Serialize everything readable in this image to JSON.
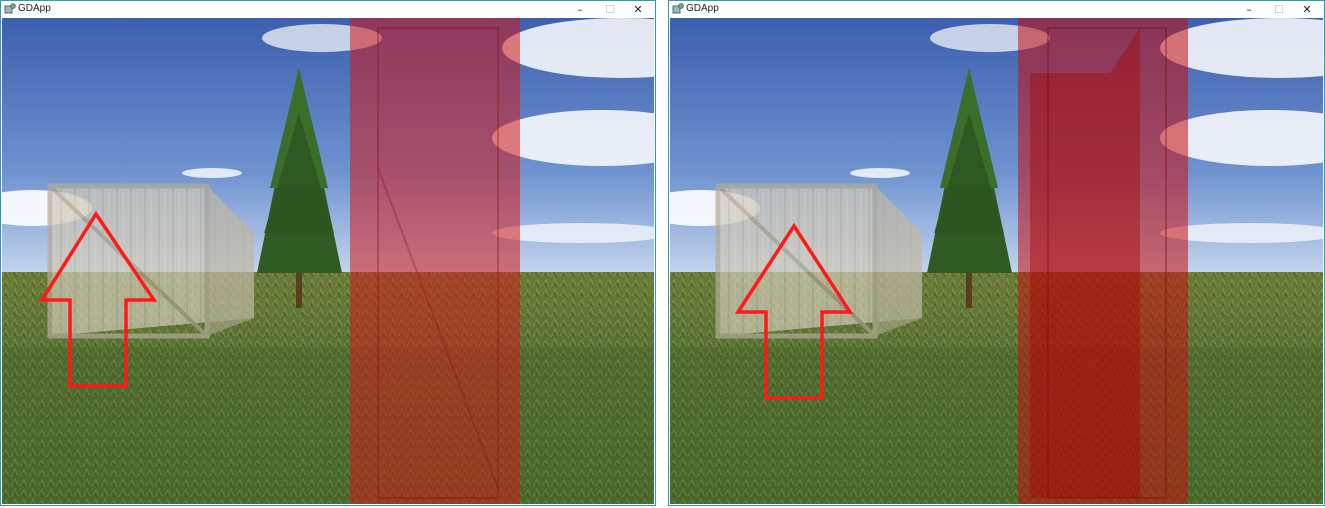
{
  "windows": [
    {
      "title": "GDApp",
      "controls": {
        "minimize": "–",
        "maximize": "☐",
        "close": "✕"
      },
      "scene": {
        "red_overlay_color": "#d11a1a",
        "arrow_color": "#ff1a1a"
      }
    },
    {
      "title": "GDApp",
      "controls": {
        "minimize": "–",
        "maximize": "☐",
        "close": "✕"
      },
      "scene": {
        "red_overlay_color": "#c90e0e",
        "arrow_color": "#ff1a1a"
      }
    }
  ]
}
